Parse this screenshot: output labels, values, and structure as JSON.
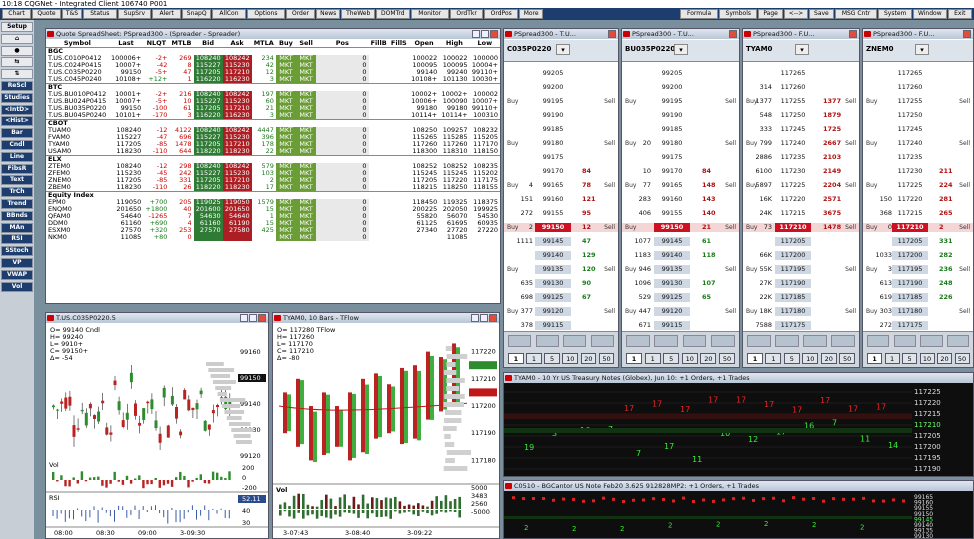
{
  "app": {
    "title": "10:18 CQGNet - Integrated Client 106740 P001"
  },
  "menu": [
    "Chart",
    "Quote",
    "T&S",
    "Status",
    "SupSrv",
    "Alert",
    "SnapQ",
    "AllCon",
    "Options",
    "Order",
    "News",
    "TheWeb",
    "DOMTrd",
    "Monitor",
    "OrdTkr",
    "OrdPos",
    "More"
  ],
  "menu_right": [
    "Formula",
    "Symbols",
    "Page",
    "<-->",
    "Save",
    "MSG Cntr",
    "System",
    "Window",
    "Exit"
  ],
  "sidebar": [
    "Setup",
    "Cndl",
    "Line",
    "FibsR",
    "Text",
    "TrCh",
    "Trend",
    "BBnds",
    "MAn",
    "RSI",
    "SStoch",
    "VP",
    "VWAP",
    "Vol"
  ],
  "sidebar_tools": [
    "Setup",
    "⌂",
    "●",
    "⇆",
    "⇅",
    "ReScl",
    "Studies",
    "<IntD>",
    "<Hist>",
    "Bar",
    "Cndl",
    "Line",
    "FibsR",
    "Text",
    "TrCh",
    "Trend",
    "BBnds",
    "MAn",
    "RSI",
    "SStoch",
    "VP",
    "VWAP",
    "Vol"
  ],
  "spreadsheet": {
    "title": "Quote SpreadSheet: PSpread300 - (Spreader - Spreader)",
    "headers": [
      "Symbol",
      "Last",
      "NLQT",
      "MTLB",
      "Bid",
      "Ask",
      "MTLA",
      "Buy",
      "Sell",
      "Pos",
      "FillB",
      "FillS",
      "Open",
      "High",
      "Low"
    ],
    "groups": [
      {
        "name": "BGC",
        "rows": [
          [
            "T.US.C010P0412",
            "100006+",
            "-2+",
            "269",
            "108240",
            "108242",
            "234",
            "MKT",
            "MKT",
            "0",
            "",
            "",
            "100022",
            "100022",
            "100000"
          ],
          [
            "T.US.C024P0415",
            "10007+",
            "-42",
            "8",
            "115227",
            "115230",
            "42",
            "MKT",
            "MKT",
            "0",
            "",
            "",
            "100095",
            "100095",
            "10004+"
          ],
          [
            "T.US.C035P0220",
            "99150",
            "-5+",
            "47",
            "117205",
            "117210",
            "12",
            "MKT",
            "MKT",
            "0",
            "",
            "",
            "99140",
            "99240",
            "99110+"
          ],
          [
            "T.US.C045P0240",
            "10108+",
            "+12+",
            "1",
            "116220",
            "116230",
            "3",
            "MKT",
            "MKT",
            "0",
            "",
            "",
            "10108+",
            "101130",
            "10030+"
          ]
        ]
      },
      {
        "name": "BTC",
        "rows": [
          [
            "T.US.BU010P0412",
            "10001+",
            "-2+",
            "216",
            "108240",
            "108242",
            "197",
            "MKT",
            "MKT",
            "0",
            "",
            "",
            "10002+",
            "10002+",
            "100002"
          ],
          [
            "T.US.BU024P0415",
            "10007+",
            "-5+",
            "10",
            "115227",
            "115230",
            "60",
            "MKT",
            "MKT",
            "0",
            "",
            "",
            "10006+",
            "100090",
            "10007+"
          ],
          [
            "T.US.BU035P0220",
            "99150",
            "-100",
            "61",
            "117205",
            "117210",
            "21",
            "MKT",
            "MKT",
            "0",
            "",
            "",
            "99180",
            "99180",
            "99110+"
          ],
          [
            "T.US.BU045P0240",
            "10101+",
            "-170",
            "3",
            "116220",
            "116230",
            "3",
            "MKT",
            "MKT",
            "0",
            "",
            "",
            "10114+",
            "10114+",
            "100310"
          ]
        ]
      },
      {
        "name": "CBOT",
        "rows": [
          [
            "TUAM0",
            "108240",
            "-12",
            "4122",
            "108240",
            "108242",
            "4447",
            "MKT",
            "MKT",
            "0",
            "",
            "",
            "108250",
            "109257",
            "108232"
          ],
          [
            "FVAM0",
            "115227",
            "-47",
            "696",
            "115227",
            "115230",
            "396",
            "MKT",
            "MKT",
            "0",
            "",
            "",
            "115265",
            "115285",
            "115205"
          ],
          [
            "TYAM0",
            "117205",
            "-85",
            "1478",
            "117205",
            "117210",
            "178",
            "MKT",
            "MKT",
            "0",
            "",
            "",
            "117260",
            "117260",
            "117170"
          ],
          [
            "USAM0",
            "118230",
            "-110",
            "644",
            "118220",
            "118230",
            "22",
            "MKT",
            "MKT",
            "0",
            "",
            "",
            "118300",
            "118310",
            "118150"
          ]
        ]
      },
      {
        "name": "ELX",
        "rows": [
          [
            "ZTEM0",
            "108240",
            "-12",
            "298",
            "108240",
            "108242",
            "579",
            "MKT",
            "MKT",
            "0",
            "",
            "",
            "108252",
            "108252",
            "108235"
          ],
          [
            "ZFEM0",
            "115230",
            "-45",
            "242",
            "115227",
            "115230",
            "103",
            "MKT",
            "MKT",
            "0",
            "",
            "",
            "115245",
            "115245",
            "115202"
          ],
          [
            "ZNEM0",
            "117205",
            "-85",
            "331",
            "117205",
            "117210",
            "2",
            "MKT",
            "MKT",
            "0",
            "",
            "",
            "117205",
            "117220",
            "117175"
          ],
          [
            "ZBEM0",
            "118230",
            "-110",
            "26",
            "118220",
            "118230",
            "17",
            "MKT",
            "MKT",
            "0",
            "",
            "",
            "118215",
            "118250",
            "118155"
          ]
        ]
      },
      {
        "name": "Equity Index",
        "rows": [
          [
            "EPM0",
            "119050",
            "+700",
            "205",
            "119025",
            "119050",
            "1579",
            "MKT",
            "MKT",
            "0",
            "",
            "",
            "118450",
            "119325",
            "118375"
          ],
          [
            "ENQM0",
            "201650",
            "+1800",
            "40",
            "201600",
            "201650",
            "15",
            "MKT",
            "MKT",
            "0",
            "",
            "",
            "200225",
            "202050",
            "199925"
          ],
          [
            "QFAM0",
            "54640",
            "-1265",
            "7",
            "54630",
            "54640",
            "1",
            "MKT",
            "MKT",
            "0",
            "",
            "",
            "55820",
            "56070",
            "54530"
          ],
          [
            "DDM0",
            "61160",
            "+690",
            "4",
            "61160",
            "61190",
            "15",
            "MKT",
            "MKT",
            "0",
            "",
            "",
            "61125",
            "61695",
            "60935"
          ],
          [
            "ESXM0",
            "27570",
            "+320",
            "253",
            "27570",
            "27580",
            "425",
            "MKT",
            "MKT",
            "0",
            "",
            "",
            "27340",
            "27720",
            "27220"
          ],
          [
            "NKM0",
            "11085",
            "+80",
            "0",
            "",
            "",
            "",
            "MKT",
            "MKT",
            "0",
            "",
            "",
            "",
            "11085",
            ""
          ]
        ]
      }
    ]
  },
  "dom": [
    {
      "title": "PSpread300 - T.U...",
      "sym": "C035P0220",
      "prices": [
        "99205",
        "99200",
        "99195",
        "99190",
        "99185",
        "99180",
        "99175",
        "99170",
        "99165",
        "99160",
        "99155",
        "99150",
        "99145",
        "99140",
        "99135",
        "99130",
        "99125",
        "99120",
        "99115",
        "99110"
      ],
      "bids": [
        "",
        "",
        "",
        "",
        "",
        "",
        "",
        "",
        "4",
        "151",
        "272",
        "2",
        "1111",
        "",
        "",
        "635",
        "698",
        "377",
        "378",
        "302"
      ],
      "asks": [
        "",
        "",
        "",
        "",
        "",
        "",
        "",
        "84",
        "78",
        "121",
        "95",
        "12",
        "47",
        "129",
        "120",
        "90",
        "67",
        "",
        "",
        ""
      ],
      "last": "99150"
    },
    {
      "title": "PSpread300 - T.U...",
      "sym": "BU035P0220",
      "prices": [
        "99205",
        "99200",
        "99195",
        "99190",
        "99185",
        "99180",
        "99175",
        "99170",
        "99165",
        "99160",
        "99155",
        "99150",
        "99145",
        "99140",
        "99135",
        "99130",
        "99125",
        "99120",
        "99115",
        "99110"
      ],
      "bids": [
        "",
        "",
        "",
        "",
        "",
        "20",
        "",
        "10",
        "77",
        "283",
        "406",
        "",
        "1077",
        "1183",
        "946",
        "1096",
        "529",
        "447",
        "671",
        ""
      ],
      "asks": [
        "",
        "",
        "",
        "",
        "",
        "",
        "",
        "84",
        "148",
        "143",
        "140",
        "21",
        "61",
        "118",
        "",
        "107",
        "65",
        "",
        "",
        ""
      ],
      "last": "99150"
    },
    {
      "title": "PSpread300 - F.U...",
      "sym": "TYAM0",
      "prices": [
        "117265",
        "117260",
        "117255",
        "117250",
        "117245",
        "117240",
        "117235",
        "117230",
        "117225",
        "117220",
        "117215",
        "117210",
        "117205",
        "117200",
        "117195",
        "117190",
        "117185",
        "117180",
        "117175",
        "117170"
      ],
      "bids": [
        "",
        "314",
        "1377",
        "548",
        "333",
        "799",
        "2886",
        "6100",
        "5897",
        "16K",
        "24K",
        "73",
        "",
        "66K",
        "55K",
        "27K",
        "22K",
        "18K",
        "7588",
        "169"
      ],
      "asks": [
        "",
        "",
        "1377",
        "1879",
        "1725",
        "2667",
        "2103",
        "2149",
        "2204",
        "2571",
        "3675",
        "1478",
        "",
        "",
        "",
        "",
        "",
        "",
        "",
        ""
      ],
      "last": "117210"
    },
    {
      "title": "PSpread300 - F.U...",
      "sym": "ZNEM0",
      "prices": [
        "117265",
        "117260",
        "117255",
        "117250",
        "117245",
        "117240",
        "117235",
        "117230",
        "117225",
        "117220",
        "117215",
        "117210",
        "117205",
        "117200",
        "117195",
        "117190",
        "117185",
        "117180",
        "117175",
        "117170"
      ],
      "bids": [
        "",
        "",
        "",
        "",
        "",
        "",
        "",
        "",
        "",
        "150",
        "368",
        "0",
        "",
        "1033",
        "3",
        "613",
        "619",
        "303",
        "272",
        ""
      ],
      "asks": [
        "",
        "",
        "",
        "",
        "",
        "",
        "",
        "211",
        "224",
        "281",
        "265",
        "2",
        "331",
        "282",
        "236",
        "248",
        "226",
        "",
        "",
        ""
      ],
      "last": "117210"
    }
  ],
  "dom_qty": [
    "1",
    "1",
    "5",
    "10",
    "20",
    "50"
  ],
  "charts": {
    "c1": {
      "title": "T.US.C035P0220.5",
      "info": [
        "O= 99140 Cndl",
        "H= 99240",
        "L= 9910+",
        "C= 99150+",
        "Δ= -54"
      ],
      "axis": [
        "99160",
        "99150",
        "99140",
        "99130",
        "99120"
      ],
      "vol": "Vol",
      "vol_axis": [
        "200",
        "0",
        "-200"
      ],
      "rsi": "RSI",
      "rsi_axis": [
        "52.11",
        "40",
        "30"
      ],
      "times": [
        "08:00",
        "08:30",
        "09:00",
        "3-09:30"
      ]
    },
    "c2": {
      "title": "TYAM0, 10 Bars - TFlow",
      "info": [
        "O= 117280 TFlow",
        "H= 117260",
        "L= 117170",
        "C= 117210",
        "Δ= -80"
      ],
      "axis": [
        "117220",
        "117210",
        "117200",
        "117190",
        "117180"
      ],
      "vol": "Vol",
      "vol_axis": [
        "5000",
        "3483",
        "2560",
        "-5000"
      ],
      "times": [
        "3-07:43",
        "3-08:40",
        "3-09:22"
      ]
    },
    "c3": {
      "title": "TYAM0 - 10 Yr US Treasury Notes (Globex), Jun 10: +1 Orders, +1 Trades",
      "axis": [
        "117225",
        "117220",
        "117215",
        "117210",
        "117205",
        "117200",
        "117195",
        "117190"
      ]
    },
    "c4": {
      "title": "C0510 - BGCantor US Note Feb20 3.625 912828MP2: +1 Orders, +1 Trades",
      "axis": [
        "99165",
        "99160",
        "99155",
        "99150",
        "99145",
        "99140",
        "99135",
        "99130"
      ]
    }
  },
  "colors": {
    "bg": "#7a8f9e",
    "menubar": "#1c3d6e",
    "bid": "#2f7a34",
    "ask": "#ab1f24",
    "mkt": "#6a9d35"
  }
}
